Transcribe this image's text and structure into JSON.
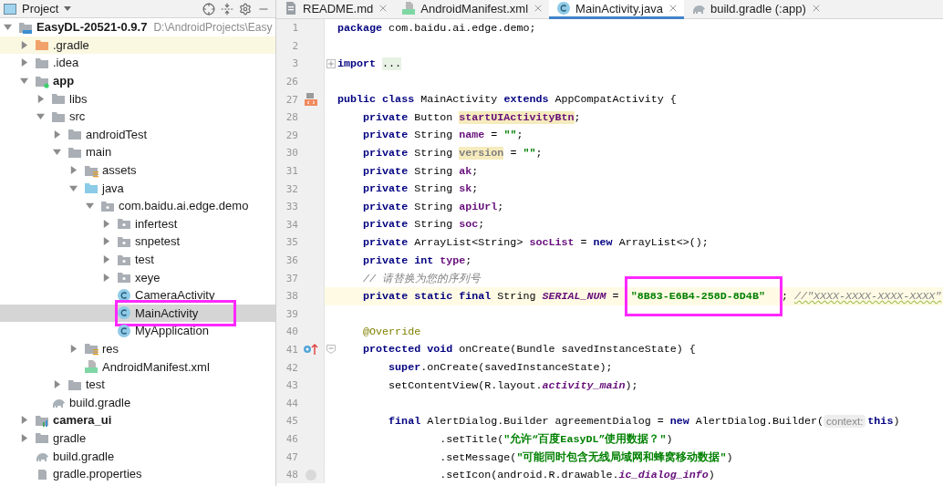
{
  "project_panel": {
    "title": "Project",
    "tree": [
      {
        "label": "EasyDL-20521-0.9.7",
        "path": "D:\\AndroidProjects\\Easy",
        "kind": "module",
        "bold": true,
        "expanded": true,
        "selected": false,
        "annotated": false,
        "children": [
          {
            "label": ".gradle",
            "kind": "excluded-folder",
            "bold": false,
            "expanded": false,
            "selected": false,
            "annotated": false
          },
          {
            "label": ".idea",
            "kind": "folder",
            "bold": false,
            "expanded": false,
            "selected": false,
            "annotated": false
          },
          {
            "label": "app",
            "kind": "module-app",
            "bold": true,
            "expanded": true,
            "selected": false,
            "annotated": false,
            "children": [
              {
                "label": "libs",
                "kind": "folder",
                "bold": false,
                "expanded": false,
                "selected": false,
                "annotated": false
              },
              {
                "label": "src",
                "kind": "folder",
                "bold": false,
                "expanded": true,
                "selected": false,
                "annotated": false,
                "children": [
                  {
                    "label": "androidTest",
                    "kind": "folder",
                    "bold": false,
                    "expanded": false,
                    "selected": false,
                    "annotated": false
                  },
                  {
                    "label": "main",
                    "kind": "folder",
                    "bold": false,
                    "expanded": true,
                    "selected": false,
                    "annotated": false,
                    "children": [
                      {
                        "label": "assets",
                        "kind": "resource-folder",
                        "bold": false,
                        "expanded": false,
                        "selected": false,
                        "annotated": false
                      },
                      {
                        "label": "java",
                        "kind": "source-folder",
                        "bold": false,
                        "expanded": true,
                        "selected": false,
                        "annotated": false,
                        "children": [
                          {
                            "label": "com.baidu.ai.edge.demo",
                            "kind": "package",
                            "bold": false,
                            "expanded": true,
                            "selected": false,
                            "annotated": false,
                            "children": [
                              {
                                "label": "infertest",
                                "kind": "package",
                                "bold": false,
                                "expanded": false,
                                "selected": false,
                                "annotated": false
                              },
                              {
                                "label": "snpetest",
                                "kind": "package",
                                "bold": false,
                                "expanded": false,
                                "selected": false,
                                "annotated": false
                              },
                              {
                                "label": "test",
                                "kind": "package",
                                "bold": false,
                                "expanded": false,
                                "selected": false,
                                "annotated": false
                              },
                              {
                                "label": "xeye",
                                "kind": "package",
                                "bold": false,
                                "expanded": false,
                                "selected": false,
                                "annotated": false
                              },
                              {
                                "label": "CameraActivity",
                                "kind": "class",
                                "bold": false,
                                "selected": false,
                                "annotated": false
                              },
                              {
                                "label": "MainActivity",
                                "kind": "class",
                                "bold": false,
                                "selected": true,
                                "annotated": true
                              },
                              {
                                "label": "MyApplication",
                                "kind": "class",
                                "bold": false,
                                "selected": false,
                                "annotated": false
                              }
                            ]
                          }
                        ]
                      },
                      {
                        "label": "res",
                        "kind": "resource-folder",
                        "bold": false,
                        "expanded": false,
                        "selected": false,
                        "annotated": false
                      },
                      {
                        "label": "AndroidManifest.xml",
                        "kind": "manifest",
                        "bold": false,
                        "selected": false,
                        "annotated": false
                      }
                    ]
                  },
                  {
                    "label": "test",
                    "kind": "folder",
                    "bold": false,
                    "expanded": false,
                    "selected": false,
                    "annotated": false
                  }
                ]
              },
              {
                "label": "build.gradle",
                "kind": "gradle",
                "bold": false,
                "selected": false,
                "annotated": false
              }
            ]
          },
          {
            "label": "camera_ui",
            "kind": "module-lib",
            "bold": true,
            "expanded": false,
            "selected": false,
            "annotated": false
          },
          {
            "label": "gradle",
            "kind": "folder",
            "bold": false,
            "expanded": false,
            "selected": false,
            "annotated": false
          },
          {
            "label": "build.gradle",
            "kind": "gradle",
            "bold": false,
            "selected": false,
            "annotated": false
          },
          {
            "label": "gradle.properties",
            "kind": "gradle-file",
            "bold": false,
            "selected": false,
            "annotated": false
          }
        ]
      }
    ]
  },
  "editor": {
    "tabs": [
      {
        "label": "README.md",
        "kind": "markdown",
        "selected": false
      },
      {
        "label": "AndroidManifest.xml",
        "kind": "manifest",
        "selected": false
      },
      {
        "label": "MainActivity.java",
        "kind": "class",
        "selected": true
      },
      {
        "label": "build.gradle (:app)",
        "kind": "gradle",
        "selected": false
      }
    ],
    "lines": [
      {
        "number": "1",
        "current": false,
        "tokens": [
          {
            "kind": "kw",
            "text": "package"
          },
          {
            "kind": "plain",
            "text": " com.baidu.ai.edge.demo;"
          }
        ]
      },
      {
        "number": "2",
        "current": false
      },
      {
        "number": "3",
        "current": false,
        "fold": {
          "kind": "collapsed"
        },
        "tokens": [
          {
            "kind": "kw",
            "text": "import"
          },
          {
            "kind": "folded",
            "text": "..."
          }
        ]
      },
      {
        "number": "26",
        "current": false
      },
      {
        "number": "27",
        "current": false,
        "markers": [
          {
            "kind": "layout"
          }
        ],
        "tokens": [
          {
            "kind": "kw",
            "text": "public class"
          },
          {
            "kind": "plain",
            "text": " MainActivity "
          },
          {
            "kind": "kw",
            "text": "extends"
          },
          {
            "kind": "plain",
            "text": " AppCompatActivity {"
          }
        ],
        "children": [
          {
            "number": "28",
            "current": false,
            "tokens": [
              {
                "kind": "kw",
                "text": "private"
              },
              {
                "kind": "plain",
                "text": " Button "
              },
              {
                "kind": "field-marked",
                "text": "startUIActivityBtn"
              },
              {
                "kind": "plain",
                "text": ";"
              }
            ]
          },
          {
            "number": "29",
            "current": false,
            "tokens": [
              {
                "kind": "kw",
                "text": "private"
              },
              {
                "kind": "plain",
                "text": " String "
              },
              {
                "kind": "field",
                "text": "name"
              },
              {
                "kind": "plain",
                "text": " = "
              },
              {
                "kind": "str",
                "text": "\"\""
              },
              {
                "kind": "plain",
                "text": ";"
              }
            ]
          },
          {
            "number": "30",
            "current": false,
            "tokens": [
              {
                "kind": "kw",
                "text": "private"
              },
              {
                "kind": "plain",
                "text": " String "
              },
              {
                "kind": "unused-marked",
                "text": "version"
              },
              {
                "kind": "plain",
                "text": " = "
              },
              {
                "kind": "str",
                "text": "\"\""
              },
              {
                "kind": "plain",
                "text": ";"
              }
            ]
          },
          {
            "number": "31",
            "current": false,
            "tokens": [
              {
                "kind": "kw",
                "text": "private"
              },
              {
                "kind": "plain",
                "text": " String "
              },
              {
                "kind": "field",
                "text": "ak"
              },
              {
                "kind": "plain",
                "text": ";"
              }
            ]
          },
          {
            "number": "32",
            "current": false,
            "tokens": [
              {
                "kind": "kw",
                "text": "private"
              },
              {
                "kind": "plain",
                "text": " String "
              },
              {
                "kind": "field",
                "text": "sk"
              },
              {
                "kind": "plain",
                "text": ";"
              }
            ]
          },
          {
            "number": "33",
            "current": false,
            "tokens": [
              {
                "kind": "kw",
                "text": "private"
              },
              {
                "kind": "plain",
                "text": " String "
              },
              {
                "kind": "field",
                "text": "apiUrl"
              },
              {
                "kind": "plain",
                "text": ";"
              }
            ]
          },
          {
            "number": "34",
            "current": false,
            "tokens": [
              {
                "kind": "kw",
                "text": "private"
              },
              {
                "kind": "plain",
                "text": " String "
              },
              {
                "kind": "field",
                "text": "soc"
              },
              {
                "kind": "plain",
                "text": ";"
              }
            ]
          },
          {
            "number": "35",
            "current": false,
            "tokens": [
              {
                "kind": "kw",
                "text": "private"
              },
              {
                "kind": "plain",
                "text": " ArrayList<String> "
              },
              {
                "kind": "field",
                "text": "socList"
              },
              {
                "kind": "plain",
                "text": " = "
              },
              {
                "kind": "kw",
                "text": "new"
              },
              {
                "kind": "plain",
                "text": " ArrayList<>();"
              }
            ]
          },
          {
            "number": "36",
            "current": false,
            "tokens": [
              {
                "kind": "kw",
                "text": "private int "
              },
              {
                "kind": "field",
                "text": "type"
              },
              {
                "kind": "plain",
                "text": ";"
              }
            ]
          },
          {
            "number": "37",
            "current": false,
            "tokens": [
              {
                "kind": "comment",
                "text": "// 请替换为您的序列号"
              }
            ]
          },
          {
            "number": "38",
            "current": true,
            "tokens": [
              {
                "kind": "kw",
                "text": "private static final"
              },
              {
                "kind": "plain",
                "text": " String "
              },
              {
                "kind": "static",
                "text": "SERIAL_NUM"
              },
              {
                "kind": "plain",
                "text": " = "
              },
              {
                "kind": "str-annotated",
                "text": "\"8B83-E6B4-258D-8D4B\""
              },
              {
                "kind": "plain",
                "text": "; "
              },
              {
                "kind": "comment-typo",
                "text": "//\"XXXX-XXXX-XXXX-XXXX\""
              }
            ]
          },
          {
            "number": "39",
            "current": false
          },
          {
            "number": "40",
            "current": false,
            "tokens": [
              {
                "kind": "ann",
                "text": "@Override"
              }
            ]
          },
          {
            "number": "41",
            "current": false,
            "markers": [
              {
                "kind": "override"
              }
            ],
            "fold": {
              "kind": "expanded"
            },
            "tokens": [
              {
                "kind": "kw",
                "text": "protected void"
              },
              {
                "kind": "plain",
                "text": " onCreate(Bundle savedInstanceState) {"
              }
            ],
            "children": [
              {
                "number": "42",
                "current": false,
                "tokens": [
                  {
                    "kind": "kw",
                    "text": "super"
                  },
                  {
                    "kind": "plain",
                    "text": ".onCreate(savedInstanceState);"
                  }
                ]
              },
              {
                "number": "43",
                "current": false,
                "tokens": [
                  {
                    "kind": "plain",
                    "text": "setContentView(R.layout."
                  },
                  {
                    "kind": "static",
                    "text": "activity_main"
                  },
                  {
                    "kind": "plain",
                    "text": ");"
                  }
                ]
              },
              {
                "number": "44",
                "current": false
              },
              {
                "number": "45",
                "current": false,
                "tokens": [
                  {
                    "kind": "kw",
                    "text": "final"
                  },
                  {
                    "kind": "plain",
                    "text": " AlertDialog.Builder agreementDialog = "
                  },
                  {
                    "kind": "kw",
                    "text": "new"
                  },
                  {
                    "kind": "plain",
                    "text": " AlertDialog.Builder("
                  },
                  {
                    "kind": "hint",
                    "text": "context:"
                  },
                  {
                    "kind": "kw",
                    "text": "this"
                  },
                  {
                    "kind": "plain",
                    "text": ")"
                  }
                ],
                "children": [
                  {
                    "number": "46",
                    "current": false,
                    "tokens": [
                      {
                        "kind": "chain",
                        "text": ".setTitle("
                      },
                      {
                        "kind": "str",
                        "text": "\"允许“百度EasyDL”使用数据？\""
                      },
                      {
                        "kind": "plain",
                        "text": ")"
                      }
                    ]
                  },
                  {
                    "number": "47",
                    "current": false,
                    "tokens": [
                      {
                        "kind": "chain",
                        "text": ".setMessage("
                      },
                      {
                        "kind": "str",
                        "text": "\"可能同时包含无线局域网和蜂窝移动数据\""
                      },
                      {
                        "kind": "plain",
                        "text": ")"
                      }
                    ]
                  },
                  {
                    "number": "48",
                    "current": false,
                    "markers": [
                      {
                        "kind": "info"
                      }
                    ],
                    "tokens": [
                      {
                        "kind": "chain",
                        "text": ".setIcon(android.R.drawable."
                      },
                      {
                        "kind": "static",
                        "text": "ic_dialog_info"
                      },
                      {
                        "kind": "plain",
                        "text": ")"
                      }
                    ]
                  }
                ]
              }
            ]
          }
        ]
      }
    ]
  }
}
